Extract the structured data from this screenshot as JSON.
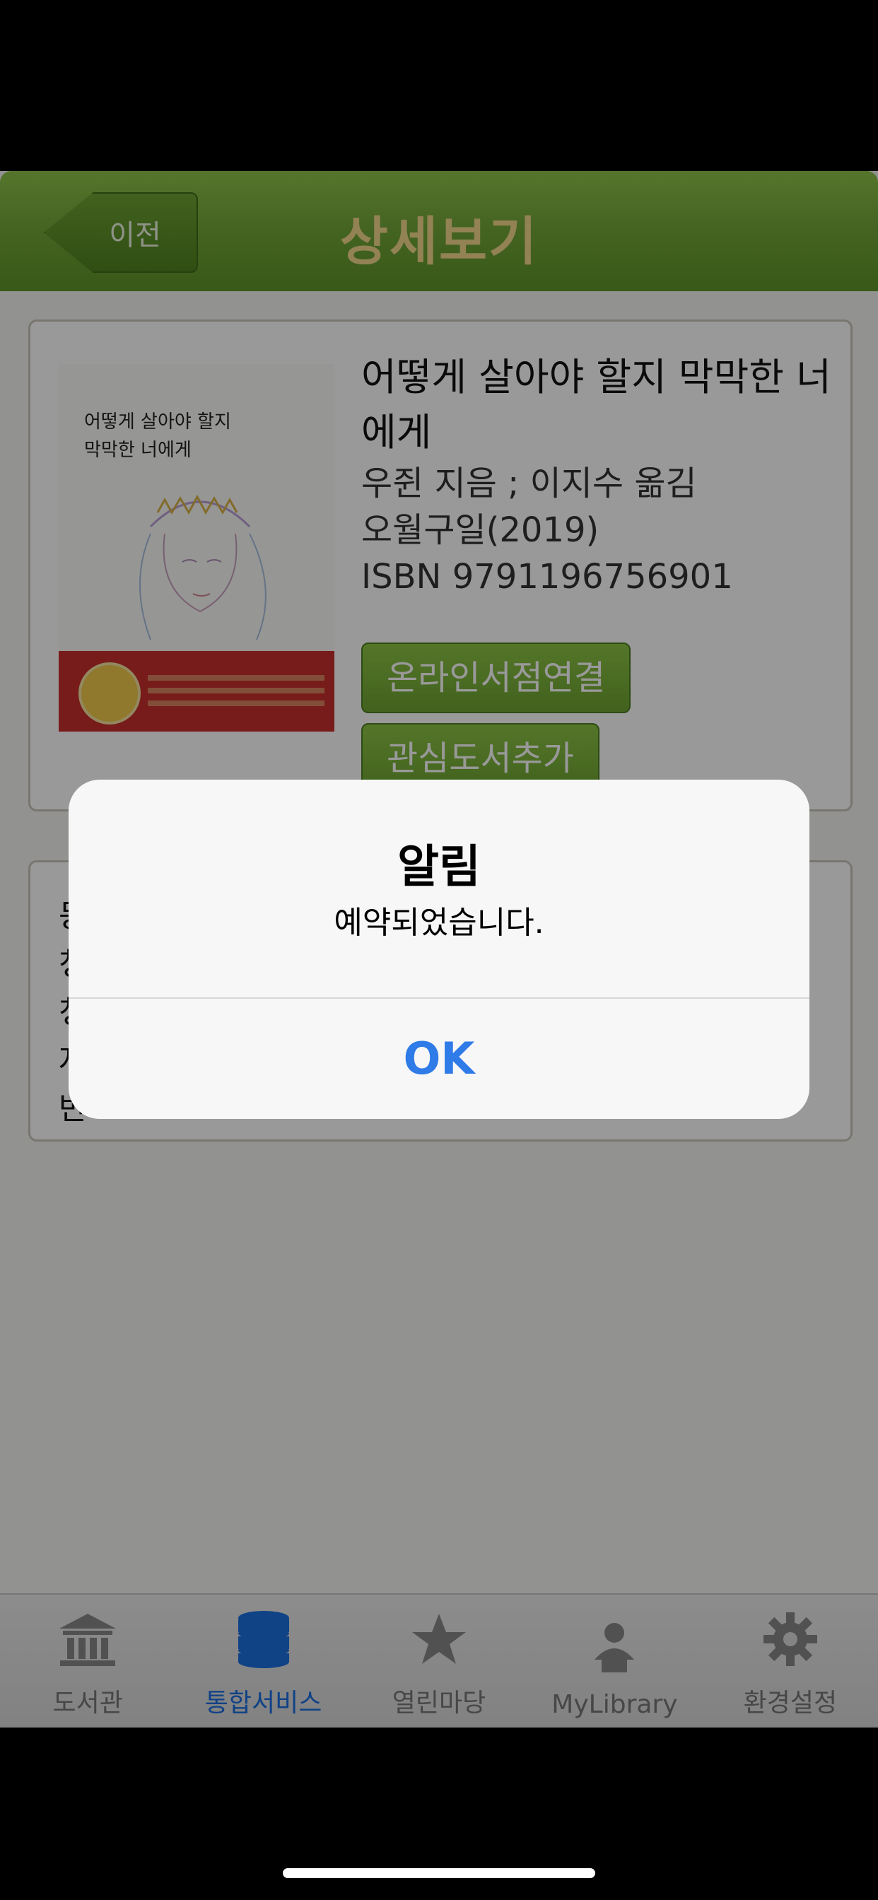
{
  "header": {
    "back_label": "이전",
    "title": "상세보기"
  },
  "book": {
    "title": "어떻게 살아야 할지 막막한 너에게",
    "author": "우쥔 지음 ; 이지수 옮김",
    "publisher": "오월구일(2019)",
    "isbn": "ISBN 9791196756901",
    "cover_title_line1": "어떻게 살아야 할지",
    "cover_title_line2": "막막한 너에게"
  },
  "actions": {
    "online_store": "온라인서점연결",
    "add_favorite": "관심도서추가"
  },
  "description": {
    "lines": [
      "등",
      "청",
      "청",
      "자",
      "반"
    ]
  },
  "alert": {
    "title": "알림",
    "message": "예약되었습니다.",
    "ok_label": "OK"
  },
  "tabbar": {
    "items": [
      {
        "label": "도서관",
        "icon": "library-building-icon"
      },
      {
        "label": "통합서비스",
        "icon": "database-icon"
      },
      {
        "label": "열린마당",
        "icon": "star-icon"
      },
      {
        "label": "MyLibrary",
        "icon": "person-icon"
      },
      {
        "label": "환경설정",
        "icon": "gear-icon"
      }
    ],
    "active_index": 1
  },
  "colors": {
    "header_green": "#74a83a",
    "title_gold": "#f3d98c",
    "active_blue": "#1c6fe0",
    "alert_ok_blue": "#2f7be8"
  }
}
